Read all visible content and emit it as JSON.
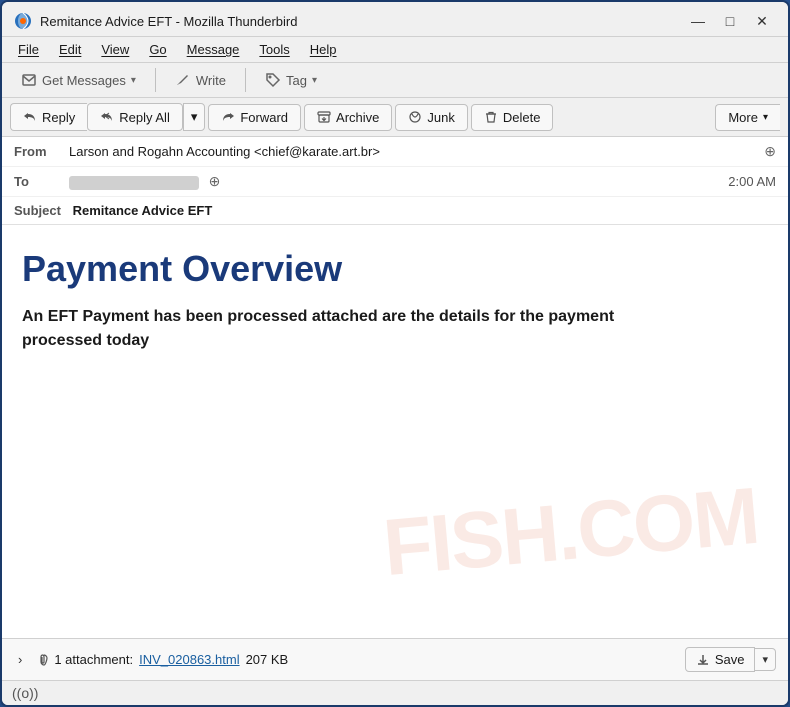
{
  "window": {
    "title": "Remitance Advice EFT - Mozilla Thunderbird",
    "icon": "thunderbird"
  },
  "titlebar": {
    "title": "Remitance Advice EFT - Mozilla Thunderbird",
    "minimize": "—",
    "maximize": "□",
    "close": "✕"
  },
  "menubar": {
    "items": [
      "File",
      "Edit",
      "View",
      "Go",
      "Message",
      "Tools",
      "Help"
    ]
  },
  "toolbar": {
    "get_messages": "Get Messages",
    "write": "Write",
    "tag": "Tag"
  },
  "actionbar": {
    "reply": "Reply",
    "reply_all": "Reply All",
    "forward": "Forward",
    "archive": "Archive",
    "junk": "Junk",
    "delete": "Delete",
    "more": "More"
  },
  "email": {
    "from_label": "From",
    "from_value": "Larson and Rogahn Accounting <chief@karate.art.br>",
    "to_label": "To",
    "time": "2:00 AM",
    "subject_label": "Subject",
    "subject_value": "Remitance Advice EFT",
    "heading": "Payment Overview",
    "body": "An EFT Payment has been processed attached are the details for the payment processed today"
  },
  "attachment": {
    "count": "1 attachment:",
    "filename": "INV_020863.html",
    "size": "207 KB",
    "save_label": "Save"
  },
  "statusbar": {
    "signal_icon": "((o))"
  }
}
